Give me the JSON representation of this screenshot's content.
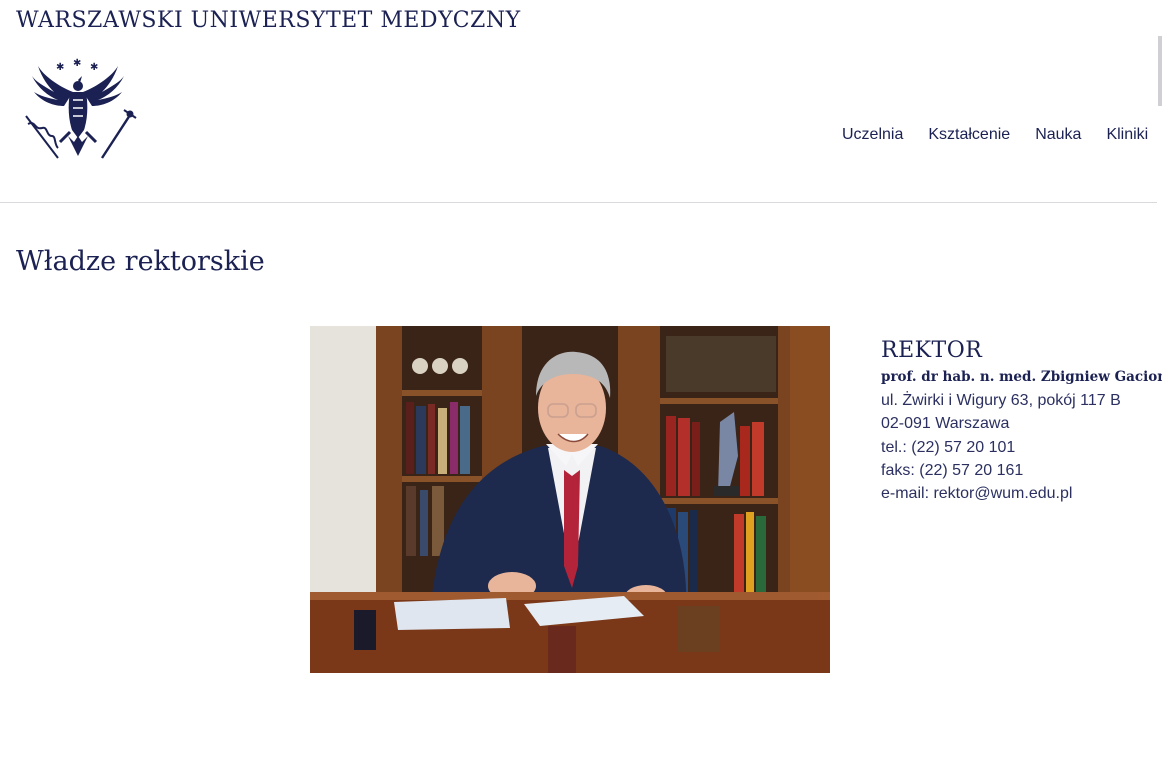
{
  "header": {
    "university_name": "WARSZAWSKI UNIWERSYTET MEDYCZNY",
    "logo": "eagle-crest-logo",
    "nav_items": [
      "Uczelnia",
      "Kształcenie",
      "Nauka",
      "Kliniki"
    ]
  },
  "main": {
    "page_title": "Władze rektorskie",
    "photo": "rector-portrait-photo",
    "contact": {
      "role": "REKTOR",
      "person": "prof. dr hab. n. med. Zbigniew Gaciong",
      "address_line1": "ul. Żwirki i Wigury 63, pokój 117 B",
      "address_line2": "02-091 Warszawa",
      "phone": "tel.: (22) 57 20 101",
      "fax": "faks: (22) 57 20 161",
      "email": "e-mail: rektor@wum.edu.pl"
    }
  },
  "colors": {
    "brand_navy": "#1b2152",
    "divider": "#d9d9de"
  }
}
